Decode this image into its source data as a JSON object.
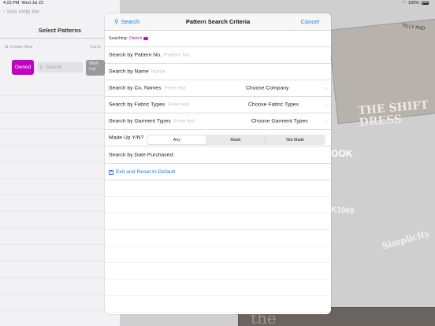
{
  "status": {
    "time": "4:23 PM",
    "date": "Wed Jul 22",
    "battery": "100%"
  },
  "background": {
    "back_label": "Sew Help Me",
    "left_title": "Select Patterns",
    "create_new": "Create New",
    "current_label": "Curre",
    "owned_chip": "Owned",
    "search_placeholder": "Search",
    "wish_chip": "Wish List",
    "mag_top": "TILLY AND",
    "mag_title": "THE SHIFT DRESS",
    "mag_book": "OOK",
    "mag_num": "K1069",
    "mag_simp": "Simplicity",
    "mag_the": "the"
  },
  "modal": {
    "nav": {
      "search": "Search",
      "title": "Pattern Search Criteria",
      "cancel": "Cancel"
    },
    "searching_label": "Searching:",
    "searching_tag": "Owned",
    "rows": {
      "pattern_no": {
        "label": "Search by Pattern No.",
        "placeholder": "Pattern No."
      },
      "name": {
        "label": "Search by Name",
        "placeholder": "Name"
      },
      "company": {
        "label": "Search by Co. Names",
        "placeholder": "Free text",
        "choose": "Choose Company"
      },
      "fabric": {
        "label": "Search by Fabric Types",
        "placeholder": "Free text",
        "choose": "Choose Fabric Types"
      },
      "garment": {
        "label": "Search by Garment Types",
        "placeholder": "Free text",
        "choose": "Choose Garment Types"
      },
      "made_up": {
        "label": "Made Up Y/N?",
        "options": [
          "Any",
          "Made",
          "Not Made"
        ],
        "selected": "Any"
      },
      "date": {
        "label": "Search by Date Purchased:"
      }
    },
    "exit_label": "Exit and Reset to Default"
  },
  "colors": {
    "accent": "#1a7cf5",
    "owned": "#c400c4"
  }
}
